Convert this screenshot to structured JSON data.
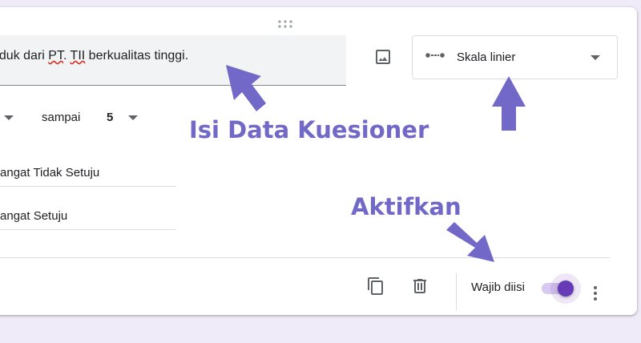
{
  "question": {
    "text_before_mark": "oduk dari ",
    "marked_1": "PT",
    "text_between": ". ",
    "marked_2": "TII",
    "text_after_mark": " berkualitas tinggi."
  },
  "type_selector": {
    "icon": "linear-scale-icon",
    "selected": "Skala linier"
  },
  "scale_range": {
    "to_word": "sampai",
    "max_value": "5"
  },
  "scale_labels": {
    "min_label": "Sangat Tidak Setuju",
    "max_label": "Sangat Setuju"
  },
  "footer": {
    "required_label": "Wajib diisi",
    "required_on": true
  },
  "annotations": {
    "fill_data": "Isi Data Kuesioner",
    "activate": "Aktifkan"
  },
  "colors": {
    "accent": "#673ab7",
    "annotation": "#7168c8",
    "background": "#f0ebf8"
  }
}
